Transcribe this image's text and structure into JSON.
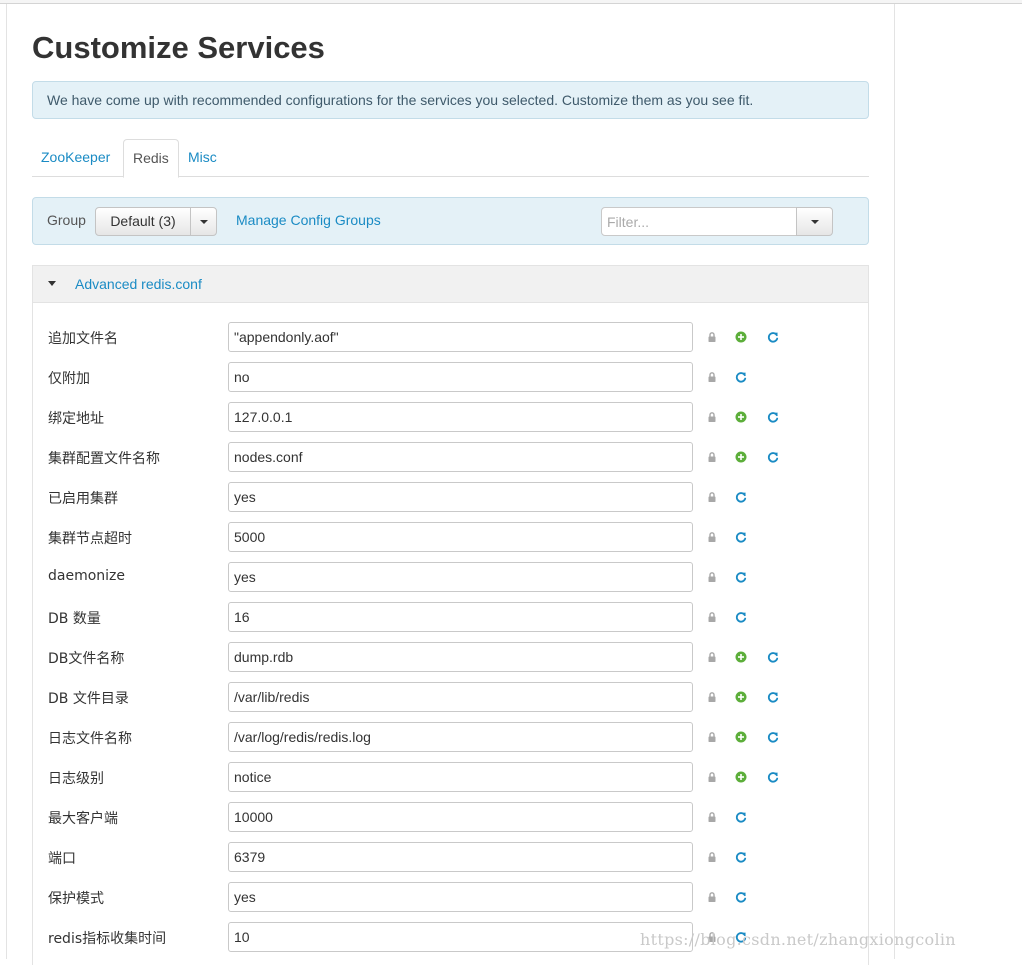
{
  "page": {
    "title": "Customize Services"
  },
  "alert": {
    "text": "We have come up with recommended configurations for the services you selected. Customize them as you see fit."
  },
  "tabs": [
    {
      "label": "ZooKeeper",
      "active": false
    },
    {
      "label": "Redis",
      "active": true
    },
    {
      "label": "Misc",
      "active": false
    }
  ],
  "groupbar": {
    "label": "Group",
    "selected": "Default (3)",
    "manage_link": "Manage Config Groups",
    "filter_placeholder": "Filter..."
  },
  "section": {
    "title": "Advanced redis.conf"
  },
  "rows": [
    {
      "label": "追加文件名",
      "value": "\"appendonly.aof\"",
      "add": true
    },
    {
      "label": "仅附加",
      "value": "no",
      "add": false
    },
    {
      "label": "绑定地址",
      "value": "127.0.0.1",
      "add": true
    },
    {
      "label": "集群配置文件名称",
      "value": "nodes.conf",
      "add": true
    },
    {
      "label": "已启用集群",
      "value": "yes",
      "add": false
    },
    {
      "label": "集群节点超时",
      "value": "5000",
      "add": false
    },
    {
      "label": "daemonize",
      "value": "yes",
      "add": false
    },
    {
      "label": "DB 数量",
      "value": "16",
      "add": false
    },
    {
      "label": "DB文件名称",
      "value": "dump.rdb",
      "add": true
    },
    {
      "label": "DB 文件目录",
      "value": "/var/lib/redis",
      "add": true
    },
    {
      "label": "日志文件名称",
      "value": "/var/log/redis/redis.log",
      "add": true
    },
    {
      "label": "日志级别",
      "value": "notice",
      "add": true
    },
    {
      "label": "最大客户端",
      "value": "10000",
      "add": false
    },
    {
      "label": "端口",
      "value": "6379",
      "add": false
    },
    {
      "label": "保护模式",
      "value": "yes",
      "add": false
    },
    {
      "label": "redis指标收集时间",
      "value": "10",
      "add": false
    }
  ],
  "icons": {
    "lock": "lock-icon",
    "add": "plus-circle-icon",
    "refresh": "refresh-icon"
  },
  "colors": {
    "link": "#1a8bc4",
    "add": "#5cb85c",
    "lock": "#999999",
    "panel": "#e4f1f7"
  },
  "watermark": "https://blog.csdn.net/zhangxiongcolin"
}
